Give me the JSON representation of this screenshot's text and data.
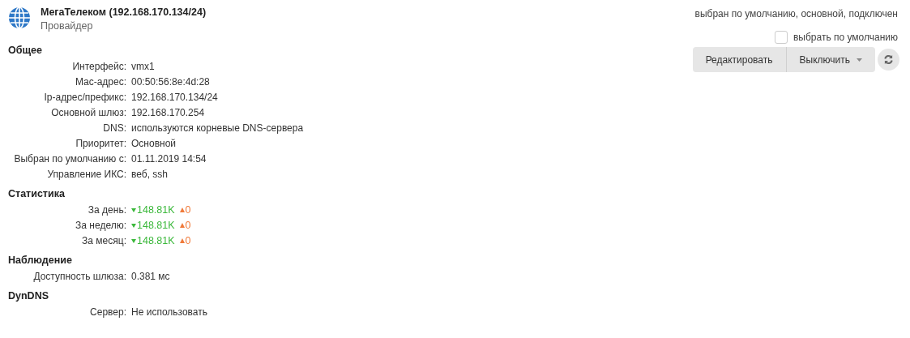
{
  "header": {
    "title": "МегаТелеком (192.168.170.134/24)",
    "subtitle": "Провайдер",
    "status": "выбран по умолчанию, основной, подключен"
  },
  "default_checkbox": {
    "label": "выбрать по умолчанию",
    "checked": false
  },
  "buttons": [
    {
      "label": "Редактировать",
      "kind": "plain"
    },
    {
      "label": "Выключить",
      "kind": "dropdown"
    }
  ],
  "sections": [
    {
      "title": "Общее",
      "rows": [
        {
          "kind": "text",
          "label": "Интерфейс:",
          "value": "vmx1"
        },
        {
          "kind": "text",
          "label": "Mac-адрес:",
          "value": "00:50:56:8e:4d:28"
        },
        {
          "kind": "text",
          "label": "Ip-адрес/префикс:",
          "value": "192.168.170.134/24"
        },
        {
          "kind": "text",
          "label": "Основной шлюз:",
          "value": "192.168.170.254"
        },
        {
          "kind": "text",
          "label": "DNS:",
          "value": "используются корневые DNS-сервера"
        },
        {
          "kind": "text",
          "label": "Приоритет:",
          "value": "Основной"
        },
        {
          "kind": "text",
          "label": "Выбран по умолчанию с:",
          "value": "01.11.2019 14:54"
        },
        {
          "kind": "text",
          "label": "Управление ИКС:",
          "value": "веб, ssh"
        }
      ]
    },
    {
      "title": "Статистика",
      "rows": [
        {
          "kind": "traffic",
          "label": "За день:",
          "down": "148.81K",
          "up": "0"
        },
        {
          "kind": "traffic",
          "label": "За неделю:",
          "down": "148.81K",
          "up": "0"
        },
        {
          "kind": "traffic",
          "label": "За месяц:",
          "down": "148.81K",
          "up": "0"
        }
      ]
    },
    {
      "title": "Наблюдение",
      "rows": [
        {
          "kind": "text",
          "label": "Доступность шлюза:",
          "value": "0.381 мс"
        }
      ]
    },
    {
      "title": "DynDNS",
      "rows": [
        {
          "kind": "text",
          "label": "Сервер:",
          "value": "Не использовать"
        }
      ]
    }
  ]
}
